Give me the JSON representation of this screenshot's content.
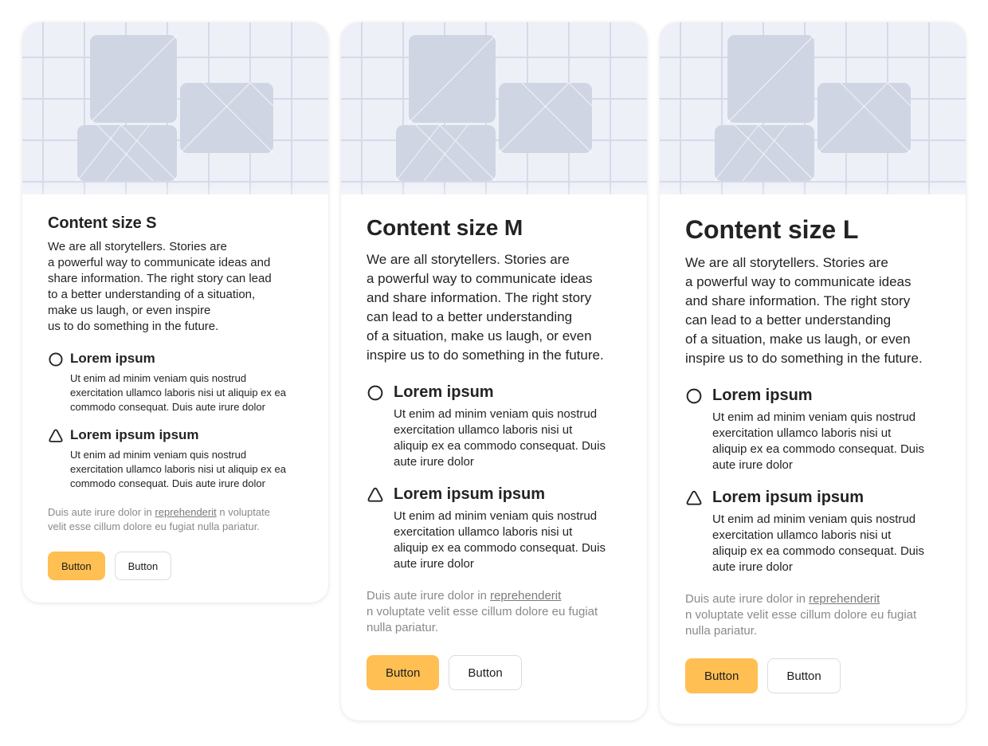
{
  "colors": {
    "accent": "#ffbf52",
    "hero_background": "#eef0f8",
    "placeholder_tile": "#cfd5e3",
    "muted_text": "#8a8a8a"
  },
  "icons": {
    "feature_1": "circle-outline-icon",
    "feature_2": "triangle-outline-icon",
    "hero": "image-placeholder-collage"
  },
  "cards": [
    {
      "title": "Content size S",
      "description": "We are all storytellers. Stories are\na powerful way to communicate ideas and\nshare information. The right story can lead\nto a better understanding of a situation,\nmake us laugh, or even inspire\nus to do something in the future.",
      "features": [
        {
          "title": "Lorem ipsum",
          "text": "Ut enim ad minim veniam quis nostrud\nexercitation ullamco laboris nisi ut aliquip ex ea\ncommodo consequat. Duis aute irure dolor"
        },
        {
          "title": "Lorem ipsum ipsum",
          "text": "Ut enim ad minim veniam quis nostrud\nexercitation ullamco laboris nisi ut aliquip ex ea\ncommodo consequat. Duis aute irure dolor"
        }
      ],
      "note_before": "Duis aute irure dolor in ",
      "note_link": "reprehenderit",
      "note_after": " n voluptate\nvelit esse cillum dolore eu fugiat nulla pariatur.",
      "primary_button": "Button",
      "secondary_button": "Button"
    },
    {
      "title": "Content size M",
      "description": "We are all storytellers. Stories are\na powerful way to communicate ideas\nand share information. The right story\ncan lead to a better understanding\nof a situation, make us laugh, or even\ninspire us to do something in the future.",
      "features": [
        {
          "title": "Lorem ipsum",
          "text": "Ut enim ad minim veniam quis nostrud\nexercitation ullamco laboris nisi ut\naliquip ex ea commodo consequat. Duis\naute irure dolor"
        },
        {
          "title": "Lorem ipsum ipsum",
          "text": "Ut enim ad minim veniam quis nostrud\nexercitation ullamco laboris nisi ut\naliquip ex ea commodo consequat. Duis\naute irure dolor"
        }
      ],
      "note_before": "Duis aute irure dolor in ",
      "note_link": "reprehenderit",
      "note_after": "\nn voluptate velit esse cillum dolore eu fugiat\nnulla pariatur.",
      "primary_button": "Button",
      "secondary_button": "Button"
    },
    {
      "title": "Content size L",
      "description": "We are all storytellers. Stories are\na powerful way to communicate ideas\nand share information. The right story\ncan lead to a better understanding\nof a situation, make us laugh, or even\ninspire us to do something in the future.",
      "features": [
        {
          "title": "Lorem ipsum",
          "text": "Ut enim ad minim veniam quis nostrud\nexercitation ullamco laboris nisi ut\naliquip ex ea commodo consequat. Duis\naute irure dolor"
        },
        {
          "title": "Lorem ipsum ipsum",
          "text": "Ut enim ad minim veniam quis nostrud\nexercitation ullamco laboris nisi ut\naliquip ex ea commodo consequat. Duis\naute irure dolor"
        }
      ],
      "note_before": "Duis aute irure dolor in ",
      "note_link": "reprehenderit",
      "note_after": "\nn voluptate velit esse cillum dolore eu fugiat\nnulla pariatur.",
      "primary_button": "Button",
      "secondary_button": "Button"
    }
  ]
}
